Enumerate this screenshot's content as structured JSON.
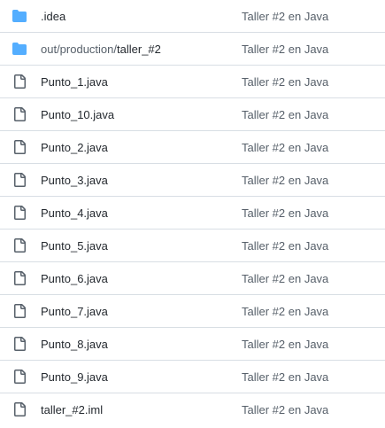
{
  "files": [
    {
      "type": "folder",
      "icon": "folder-icon",
      "dir_prefix": "",
      "name": ".idea",
      "commit": "Taller #2 en Java"
    },
    {
      "type": "folder",
      "icon": "folder-icon",
      "dir_prefix": "out/production/",
      "name": "taller_#2",
      "commit": "Taller #2 en Java"
    },
    {
      "type": "file",
      "icon": "file-icon",
      "dir_prefix": "",
      "name": "Punto_1.java",
      "commit": "Taller #2 en Java"
    },
    {
      "type": "file",
      "icon": "file-icon",
      "dir_prefix": "",
      "name": "Punto_10.java",
      "commit": "Taller #2 en Java"
    },
    {
      "type": "file",
      "icon": "file-icon",
      "dir_prefix": "",
      "name": "Punto_2.java",
      "commit": "Taller #2 en Java"
    },
    {
      "type": "file",
      "icon": "file-icon",
      "dir_prefix": "",
      "name": "Punto_3.java",
      "commit": "Taller #2 en Java"
    },
    {
      "type": "file",
      "icon": "file-icon",
      "dir_prefix": "",
      "name": "Punto_4.java",
      "commit": "Taller #2 en Java"
    },
    {
      "type": "file",
      "icon": "file-icon",
      "dir_prefix": "",
      "name": "Punto_5.java",
      "commit": "Taller #2 en Java"
    },
    {
      "type": "file",
      "icon": "file-icon",
      "dir_prefix": "",
      "name": "Punto_6.java",
      "commit": "Taller #2 en Java"
    },
    {
      "type": "file",
      "icon": "file-icon",
      "dir_prefix": "",
      "name": "Punto_7.java",
      "commit": "Taller #2 en Java"
    },
    {
      "type": "file",
      "icon": "file-icon",
      "dir_prefix": "",
      "name": "Punto_8.java",
      "commit": "Taller #2 en Java"
    },
    {
      "type": "file",
      "icon": "file-icon",
      "dir_prefix": "",
      "name": "Punto_9.java",
      "commit": "Taller #2 en Java"
    },
    {
      "type": "file",
      "icon": "file-icon",
      "dir_prefix": "",
      "name": "taller_#2.iml",
      "commit": "Taller #2 en Java"
    }
  ],
  "colors": {
    "folder": "#54aeff",
    "file_icon": "#57606a",
    "text": "#24292f",
    "muted": "#57606a",
    "divider": "#d8dee4"
  }
}
